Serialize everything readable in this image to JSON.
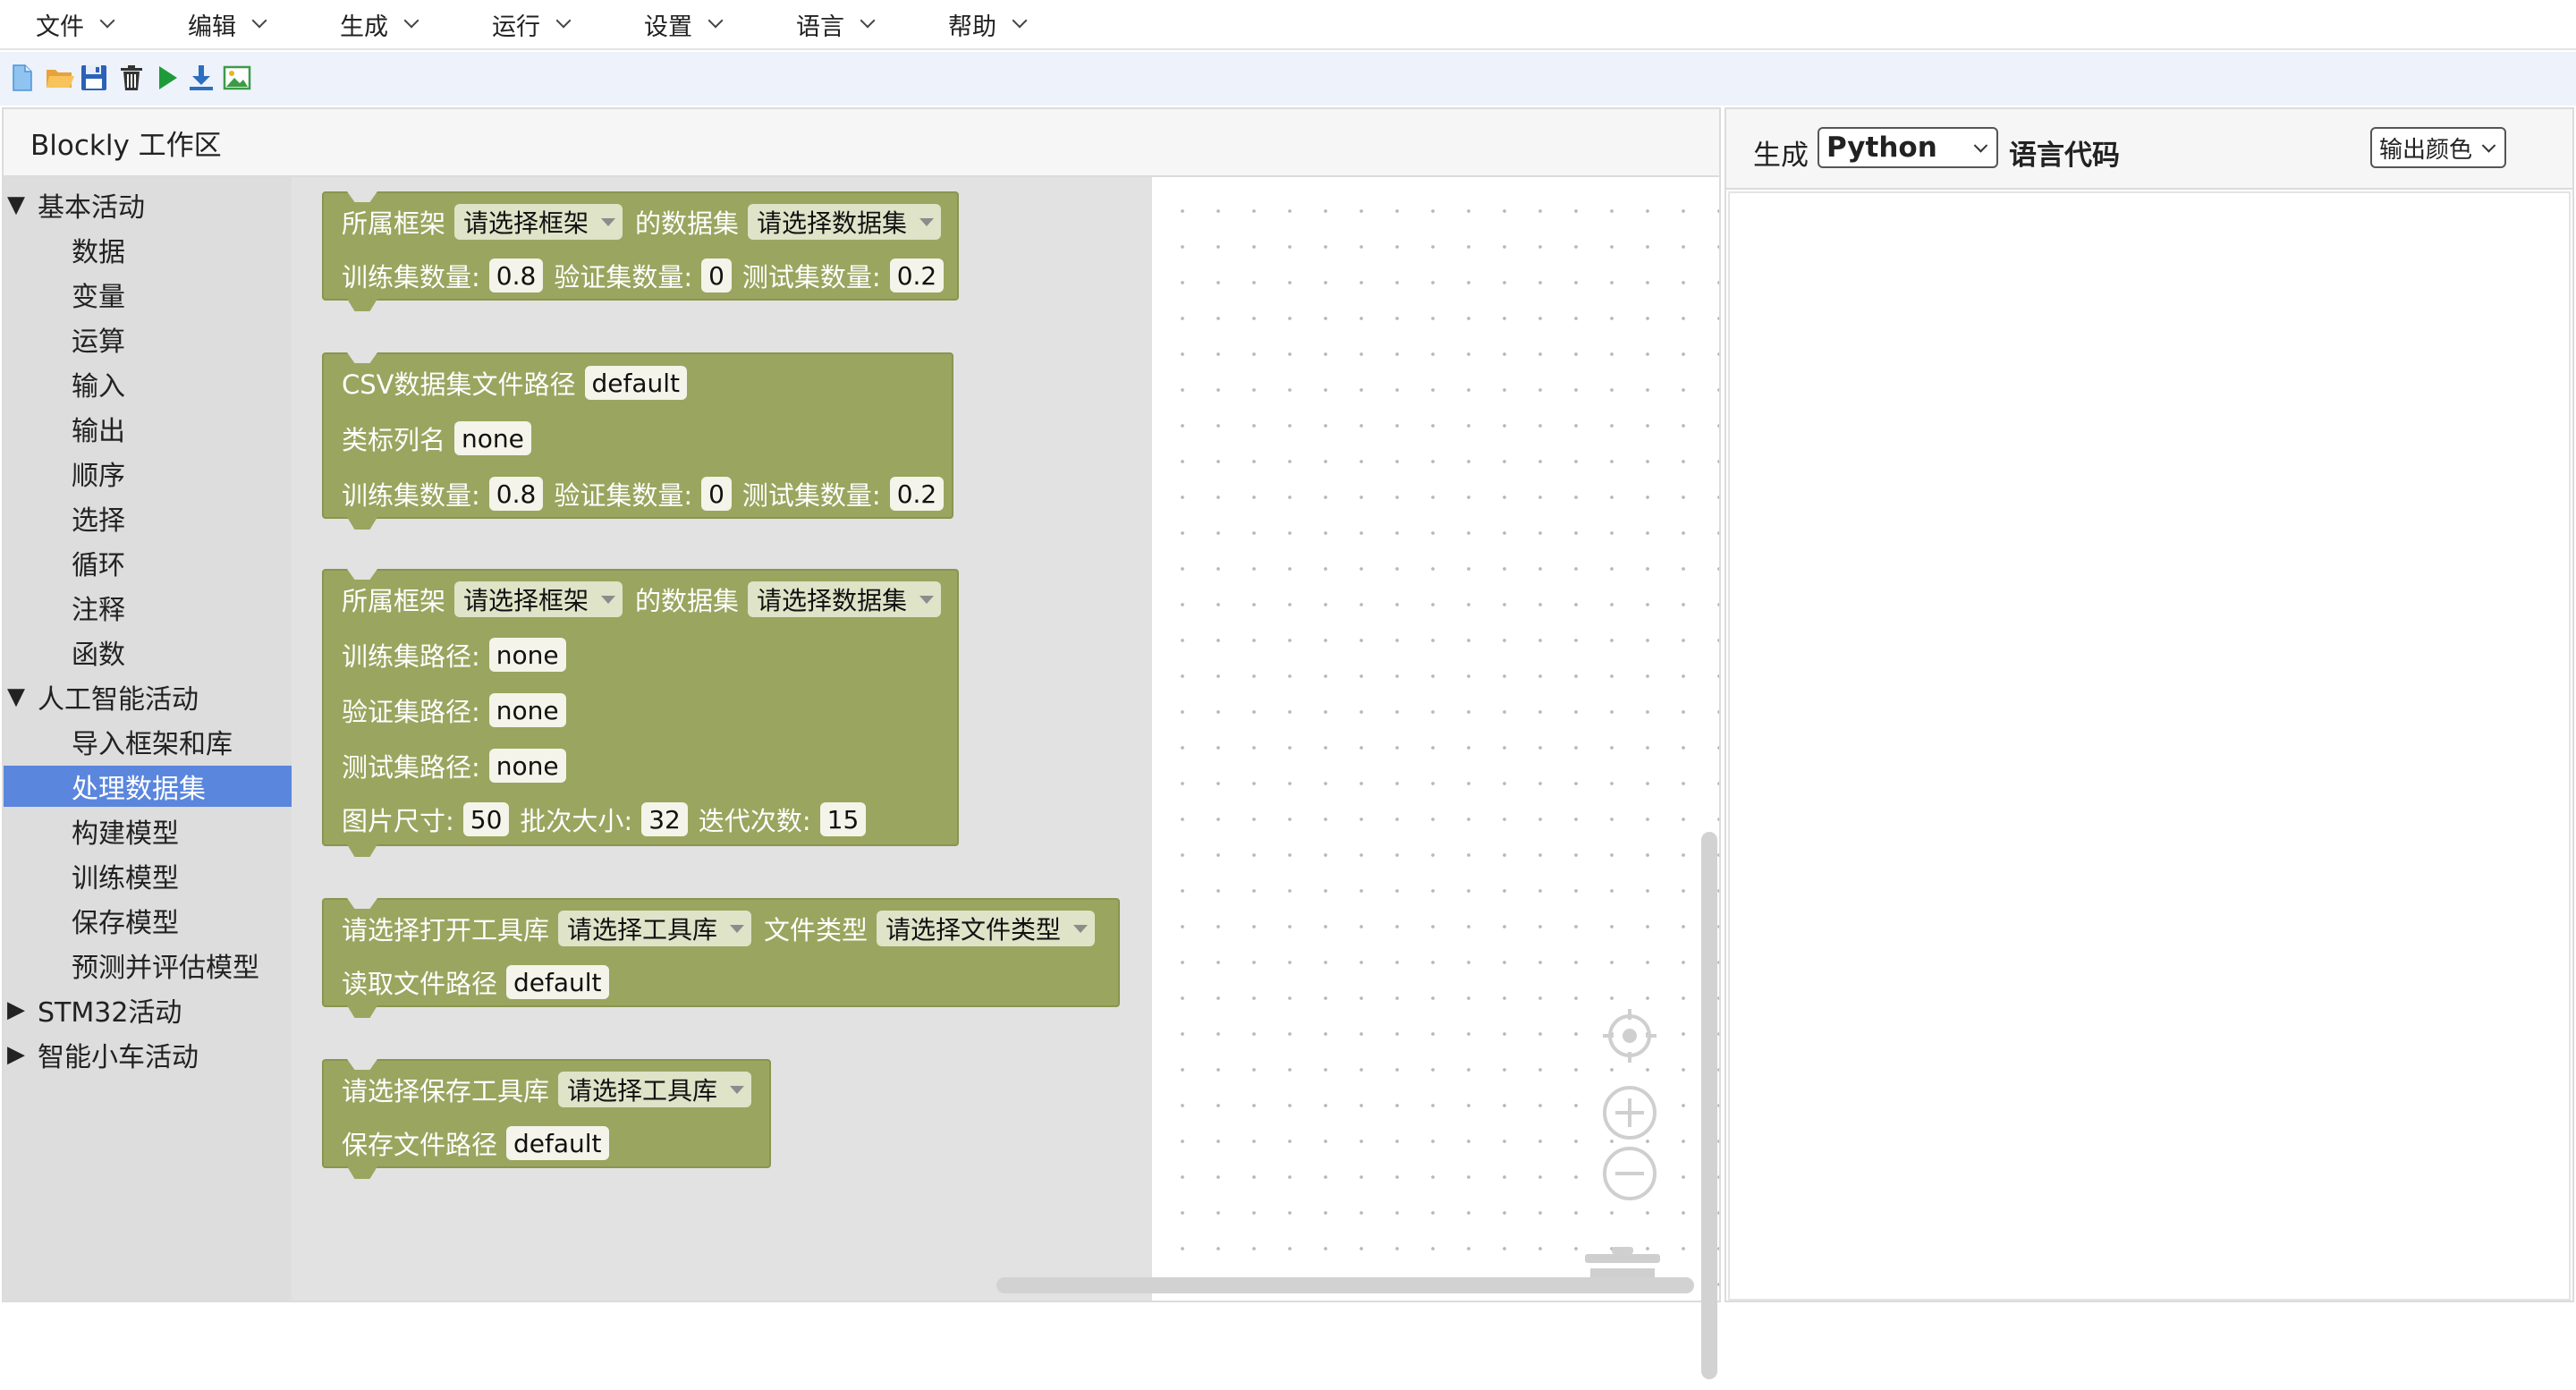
{
  "menu": [
    "文件",
    "编辑",
    "生成",
    "运行",
    "设置",
    "语言",
    "帮助"
  ],
  "toolbar": {
    "icons": [
      "new-file-icon",
      "open-folder-icon",
      "save-icon",
      "delete-icon",
      "run-icon",
      "download-icon",
      "export-image-icon"
    ]
  },
  "blockly": {
    "title": "Blockly 工作区",
    "categories": {
      "basic": "基本活动",
      "basic_items": [
        "数据",
        "变量",
        "运算",
        "输入",
        "输出",
        "顺序",
        "选择",
        "循环",
        "注释",
        "函数"
      ],
      "ai": "人工智能活动",
      "ai_items": [
        "导入框架和库",
        "处理数据集",
        "构建模型",
        "训练模型",
        "保存模型",
        "预测并评估模型"
      ],
      "stm32": "STM32活动",
      "car": "智能小车活动",
      "selected": "处理数据集"
    },
    "blocks": {
      "b1": {
        "framework_label": "所属框架",
        "framework_dd": "请选择框架",
        "dataset_label": "的数据集",
        "dataset_dd": "请选择数据集",
        "train_label": "训练集数量:",
        "train_val": "0.8",
        "valid_label": "验证集数量:",
        "valid_val": "0",
        "test_label": "测试集数量:",
        "test_val": "0.2"
      },
      "b2": {
        "csv_label": "CSV数据集文件路径",
        "csv_val": "default",
        "class_label": "类标列名",
        "class_val": "none",
        "train_label": "训练集数量:",
        "train_val": "0.8",
        "valid_label": "验证集数量:",
        "valid_val": "0",
        "test_label": "测试集数量:",
        "test_val": "0.2"
      },
      "b3": {
        "framework_label": "所属框架",
        "framework_dd": "请选择框架",
        "dataset_label": "的数据集",
        "dataset_dd": "请选择数据集",
        "train_path_label": "训练集路径:",
        "train_path_val": "none",
        "valid_path_label": "验证集路径:",
        "valid_path_val": "none",
        "test_path_label": "测试集路径:",
        "test_path_val": "none",
        "img_size_label": "图片尺寸:",
        "img_size_val": "50",
        "batch_label": "批次大小:",
        "batch_val": "32",
        "epochs_label": "迭代次数:",
        "epochs_val": "15"
      },
      "b4": {
        "open_lib_label": "请选择打开工具库",
        "open_lib_dd": "请选择工具库",
        "file_type_label": "文件类型",
        "file_type_dd": "请选择文件类型",
        "read_path_label": "读取文件路径",
        "read_path_val": "default"
      },
      "b5": {
        "save_lib_label": "请选择保存工具库",
        "save_lib_dd": "请选择工具库",
        "save_path_label": "保存文件路径",
        "save_path_val": "default"
      }
    },
    "block_color": "#9aa55f"
  },
  "code": {
    "gen_label": "生成",
    "language": "Python",
    "code_label": "语言代码",
    "color_select": "输出颜色"
  },
  "colors": {
    "accent": "#5a86dd",
    "toolbox_bg": "#dddddd",
    "flyout_bg": "#e2e2e2"
  }
}
